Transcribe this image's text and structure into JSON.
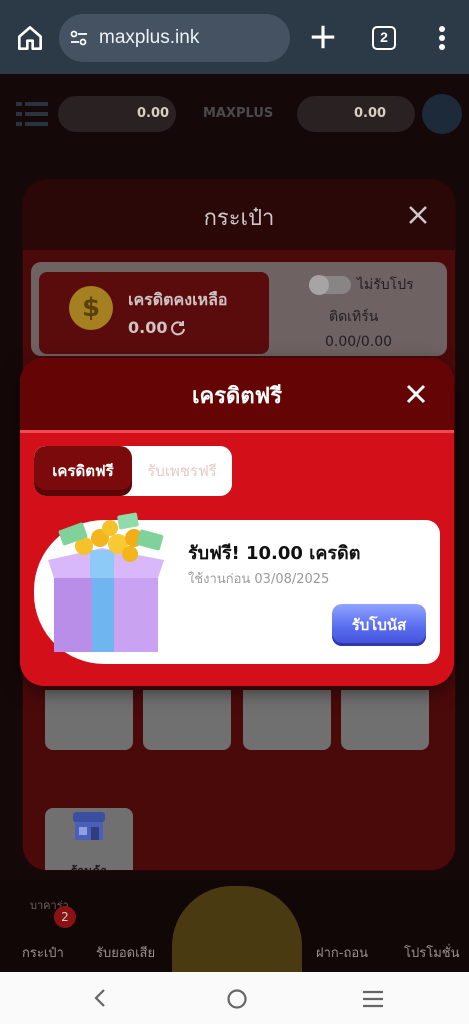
{
  "browser": {
    "url": "maxplus.ink",
    "tab_count": "2"
  },
  "page": {
    "balance_left": "0.00",
    "balance_right": "0.00",
    "brand": "MAXPLUS"
  },
  "wallet_modal": {
    "title": "กระเป๋า",
    "balance_label": "เครดิตคงเหลือ",
    "balance_value": "0.00",
    "promo_toggle_label": "ไม่รับโปร",
    "turnover_label": "ติดเทิร์น",
    "turnover_value": "0.00/0.00",
    "shop_label": "ร้านค้า"
  },
  "bottom_nav": {
    "items": [
      "กระเป๋า",
      "รับยอดเสีย",
      "ฝาก-ถอน",
      "โปรโมชั่น"
    ],
    "badge": "2",
    "partial_label": "บาคาร่า"
  },
  "credit_modal": {
    "title": "เครดิตฟรี",
    "tabs": [
      "เครดิตฟรี",
      "รับเพชรฟรี"
    ],
    "bonus_title": "รับฟรี! 10.00 เครดิต",
    "bonus_expiry": "ใช้งานก่อน 03/08/2025",
    "claim_label": "รับโบนัส"
  },
  "colors": {
    "modal_red": "#d3101a",
    "header_dark_red": "#650404",
    "claim_blue": "#5a6df0",
    "browser_bar": "#2c3947"
  }
}
